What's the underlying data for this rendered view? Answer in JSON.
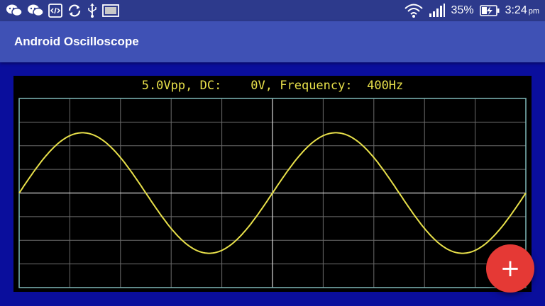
{
  "status_bar": {
    "battery_percent": "35%",
    "time": "3:24",
    "time_suffix": "pm",
    "left_icons": [
      "wechat-icon",
      "wechat-icon",
      "code-icon",
      "sync-icon",
      "usb-icon",
      "screenshot-icon"
    ],
    "right_icons": [
      "wifi-icon",
      "signal-icon",
      "battery-charging-icon"
    ]
  },
  "app_bar": {
    "title": "Android Oscilloscope"
  },
  "scope": {
    "vpp": "5.0Vpp,",
    "dc_label": "DC:",
    "dc_value": "0V,",
    "frequency_label": "Frequency:",
    "frequency_value": "400Hz",
    "trace_color": "#e8e04a",
    "grid_color": "#6b6b6b",
    "axis_color": "#d8d8d8",
    "frame_color": "#7fb8b8"
  },
  "chart_data": {
    "type": "line",
    "signal": "sine",
    "amplitude_vpp": 5.0,
    "dc_offset_v": 0,
    "frequency_hz": 400,
    "visible_cycles": 2.0,
    "grid": true,
    "grid_divisions": {
      "x": 10,
      "y": 8
    }
  },
  "fab": {
    "icon": "plus-icon"
  }
}
